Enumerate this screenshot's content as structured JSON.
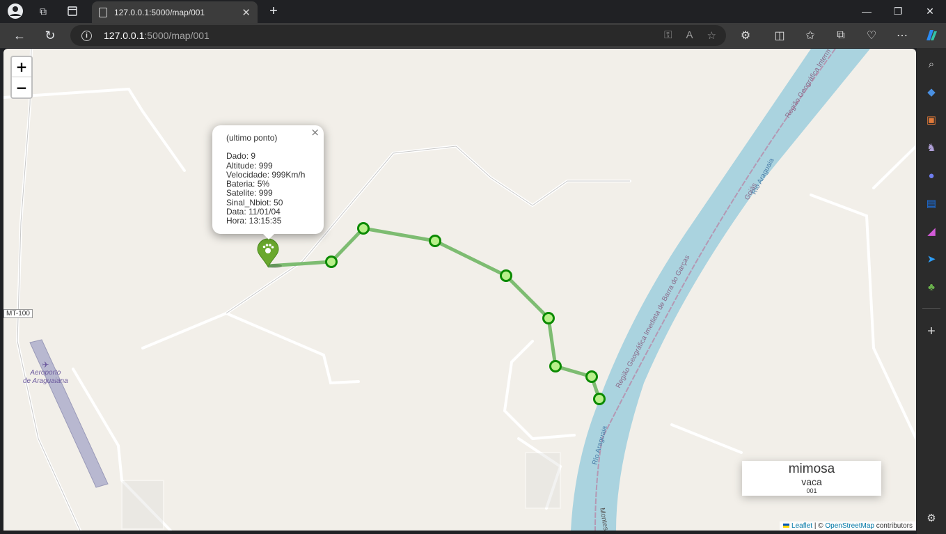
{
  "browser": {
    "tab_title": "127.0.0.1:5000/map/001",
    "url_host": "127.0.0.1",
    "url_path": ":5000/map/001"
  },
  "map": {
    "zoom_in_label": "+",
    "zoom_out_label": "−",
    "road_label": "MT-100",
    "airport_label_line1": "Aeroporto",
    "airport_label_line2": "de Araguaiana",
    "river_label_1": "Rio Araguaia",
    "river_label_2": "Rio Araguaia",
    "region_label_1": "Região Geográfica Imediata de Barra do Garças",
    "region_label_2": "Região Geográfica Interm",
    "state_label": "Goiás",
    "street_label": "Montes",
    "track_color": "#76b86a",
    "marker_color": "#0b8a00"
  },
  "popup": {
    "header": "(ultimo ponto)",
    "lines": [
      "Dado: 9",
      "Altitude: 999",
      "Velocidade: 999Km/h",
      "Bateria: 5%",
      "Satelite: 999",
      "Sinal_Nbiot: 50",
      "Data: 11/01/04",
      "Hora: 13:15:35"
    ]
  },
  "animal": {
    "name": "mimosa",
    "species": "vaca",
    "id": "001"
  },
  "attribution": {
    "leaflet": "Leaflet",
    "separator": " | © ",
    "osm": "OpenStreetMap",
    "contributors": " contributors"
  }
}
